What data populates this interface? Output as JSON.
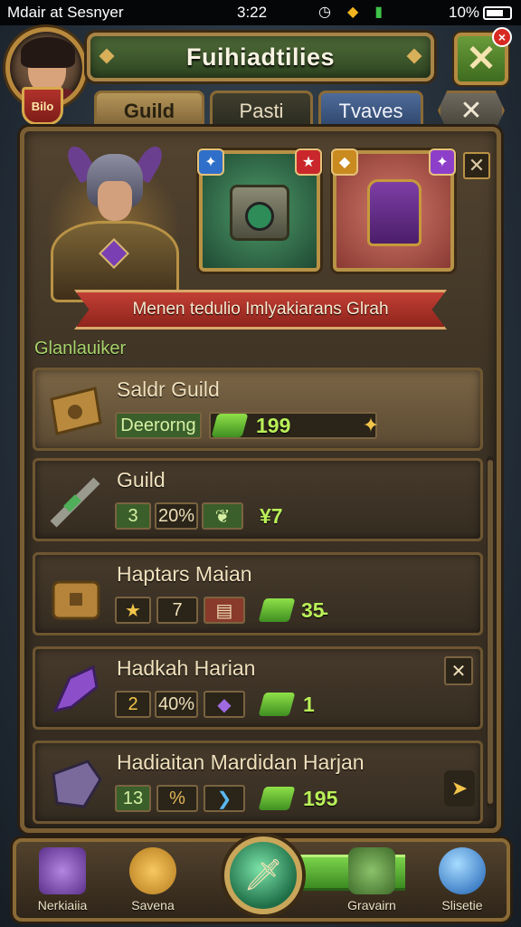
{
  "status_bar": {
    "carrier": "Mdair at Sesnyer",
    "time": "3:22",
    "battery": "10%"
  },
  "header": {
    "title": "Fuihiadtilies",
    "level_badge": "Bilo"
  },
  "tabs": [
    {
      "label": "Guild",
      "active": true
    },
    {
      "label": "Pasti",
      "active": false
    },
    {
      "label": "Tvaves",
      "active": false
    }
  ],
  "ribbon": {
    "text": "Menen tedulio Imlyakiarans Glrah"
  },
  "section_label": "Glanlauiker",
  "list": [
    {
      "title": "Saldr Guild",
      "chip1": "Deerorng",
      "value": "199"
    },
    {
      "title": "Guild",
      "chip1": "3",
      "chip2": "20%",
      "value": "¥7"
    },
    {
      "title": "Haptars Maian",
      "chip2": "7",
      "value": "35̵"
    },
    {
      "title": "Hadkah Harian",
      "chip1": "2",
      "chip2": "40%",
      "value": "1"
    },
    {
      "title": "Hadiaitan Mardidan Harjan",
      "chip1": "13",
      "chip2": "%",
      "value": "195"
    }
  ],
  "bottom_nav": [
    {
      "label": "Nerkiaiia",
      "icon": "home-icon"
    },
    {
      "label": "Savena",
      "icon": "coin-icon"
    },
    {
      "label": "",
      "icon": "sword-icon"
    },
    {
      "label": "Gravairn",
      "icon": "shield-icon"
    },
    {
      "label": "Slisetie",
      "icon": "orb-icon"
    }
  ],
  "colors": {
    "accent_green": "#b9f058",
    "gold_border": "#b89245",
    "ribbon_red": "#c23f34"
  }
}
